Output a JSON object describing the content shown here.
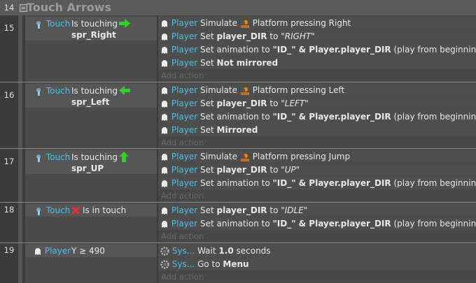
{
  "group": {
    "number": "14",
    "title": "Touch Arrows"
  },
  "events": [
    {
      "number": "15",
      "condition": {
        "object": "Touch",
        "text": "Is touching",
        "target": "spr_Right"
      },
      "actions": [
        {
          "object": "Player",
          "pre": "Simulate",
          "post": "Platform pressing Right"
        },
        {
          "object": "Player",
          "pre": "Set",
          "bold": "player_DIR",
          "mid": "to",
          "ital": "\"RIGHT\""
        },
        {
          "object": "Player",
          "pre": "Set animation to",
          "bold": "\"ID_\" & Player.player_DIR",
          "post": "(play from beginning)"
        },
        {
          "object": "Player",
          "pre": "Set",
          "bold": "Not mirrored"
        }
      ],
      "add_action": "Add action"
    },
    {
      "number": "16",
      "condition": {
        "object": "Touch",
        "text": "Is touching",
        "target": "spr_Left"
      },
      "actions": [
        {
          "object": "Player",
          "pre": "Simulate",
          "post": "Platform pressing Left"
        },
        {
          "object": "Player",
          "pre": "Set",
          "bold": "player_DIR",
          "mid": "to",
          "ital": "\"LEFT\""
        },
        {
          "object": "Player",
          "pre": "Set animation to",
          "bold": "\"ID_\" & Player.player_DIR",
          "post": "(play from beginning)"
        },
        {
          "object": "Player",
          "pre": "Set",
          "bold": "Mirrored"
        }
      ],
      "add_action": "Add action"
    },
    {
      "number": "17",
      "condition": {
        "object": "Touch",
        "text": "Is touching",
        "target": "spr_UP"
      },
      "actions": [
        {
          "object": "Player",
          "pre": "Simulate",
          "post": "Platform pressing Jump"
        },
        {
          "object": "Player",
          "pre": "Set",
          "bold": "player_DIR",
          "mid": "to",
          "ital": "\"UP\""
        },
        {
          "object": "Player",
          "pre": "Set animation to",
          "bold": "\"ID_\" & Player.player_DIR",
          "post": "(play from beginning)"
        }
      ],
      "add_action": "Add action"
    },
    {
      "number": "18",
      "condition": {
        "object": "Touch",
        "text": "Is in touch"
      },
      "actions": [
        {
          "object": "Player",
          "pre": "Set",
          "bold": "player_DIR",
          "mid": "to",
          "ital": "\"IDLE\""
        },
        {
          "object": "Player",
          "pre": "Set animation to",
          "bold": "\"ID_\" & Player.player_DIR",
          "post": "(play from beginning)"
        }
      ],
      "add_action": "Add action"
    },
    {
      "number": "19",
      "condition": {
        "object": "Player",
        "text": "Y ≥ 490"
      },
      "actions": [
        {
          "object": "Sys...",
          "pre": "Wait",
          "bold": "1.0",
          "post": "seconds"
        },
        {
          "object": "Sys...",
          "pre": "Go to",
          "bold": "Menu"
        }
      ],
      "add_action": "Add action"
    }
  ]
}
